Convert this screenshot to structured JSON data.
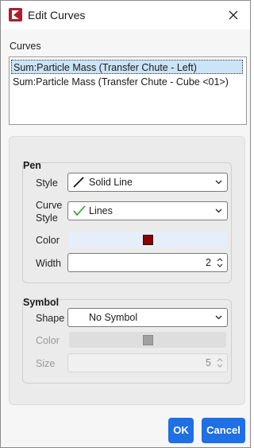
{
  "window": {
    "title": "Edit Curves",
    "close_icon": "close-icon",
    "app_icon": "app-logo-icon"
  },
  "curves": {
    "label": "Curves",
    "items": [
      "Sum:Particle Mass (Transfer Chute - Left)",
      "Sum:Particle Mass (Transfer Chute - Cube <01>)"
    ],
    "selected_index": 0
  },
  "pen": {
    "title": "Pen",
    "style_label": "Style",
    "style_value": "Solid Line",
    "curve_style_label_1": "Curve",
    "curve_style_label_2": "Style",
    "curve_style_value": "Lines",
    "color_label": "Color",
    "color_value": "#8b0000",
    "width_label": "Width",
    "width_value": "2"
  },
  "symbol": {
    "title": "Symbol",
    "shape_label": "Shape",
    "shape_value": "No Symbol",
    "color_label": "Color",
    "color_value": "#a0a0a0",
    "size_label": "Size",
    "size_value": "5"
  },
  "buttons": {
    "ok": "OK",
    "cancel": "Cancel"
  },
  "colors": {
    "accent": "#1f6fe5",
    "brand": "#b11c2a",
    "selection": "#cce4f7"
  }
}
